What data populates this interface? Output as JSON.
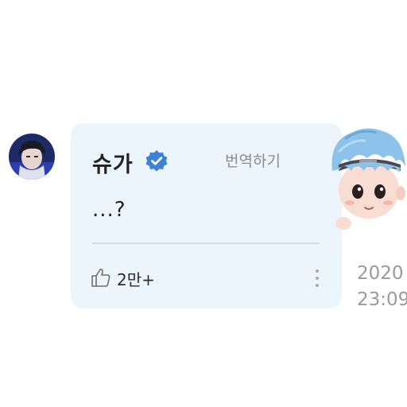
{
  "comment": {
    "author": "슈가",
    "verified_icon": "verified-badge-icon",
    "translate_label": "번역하기",
    "message": "...?",
    "like_icon": "thumbs-up-icon",
    "like_count": "2만+",
    "more_icon": "vertical-ellipsis-icon"
  },
  "timestamp": {
    "date": "2020",
    "time": "23:09"
  },
  "colors": {
    "bubble_background": "#edf5fc",
    "verified_badge": "#3b82d8",
    "muted_text": "#8c8c8c"
  }
}
